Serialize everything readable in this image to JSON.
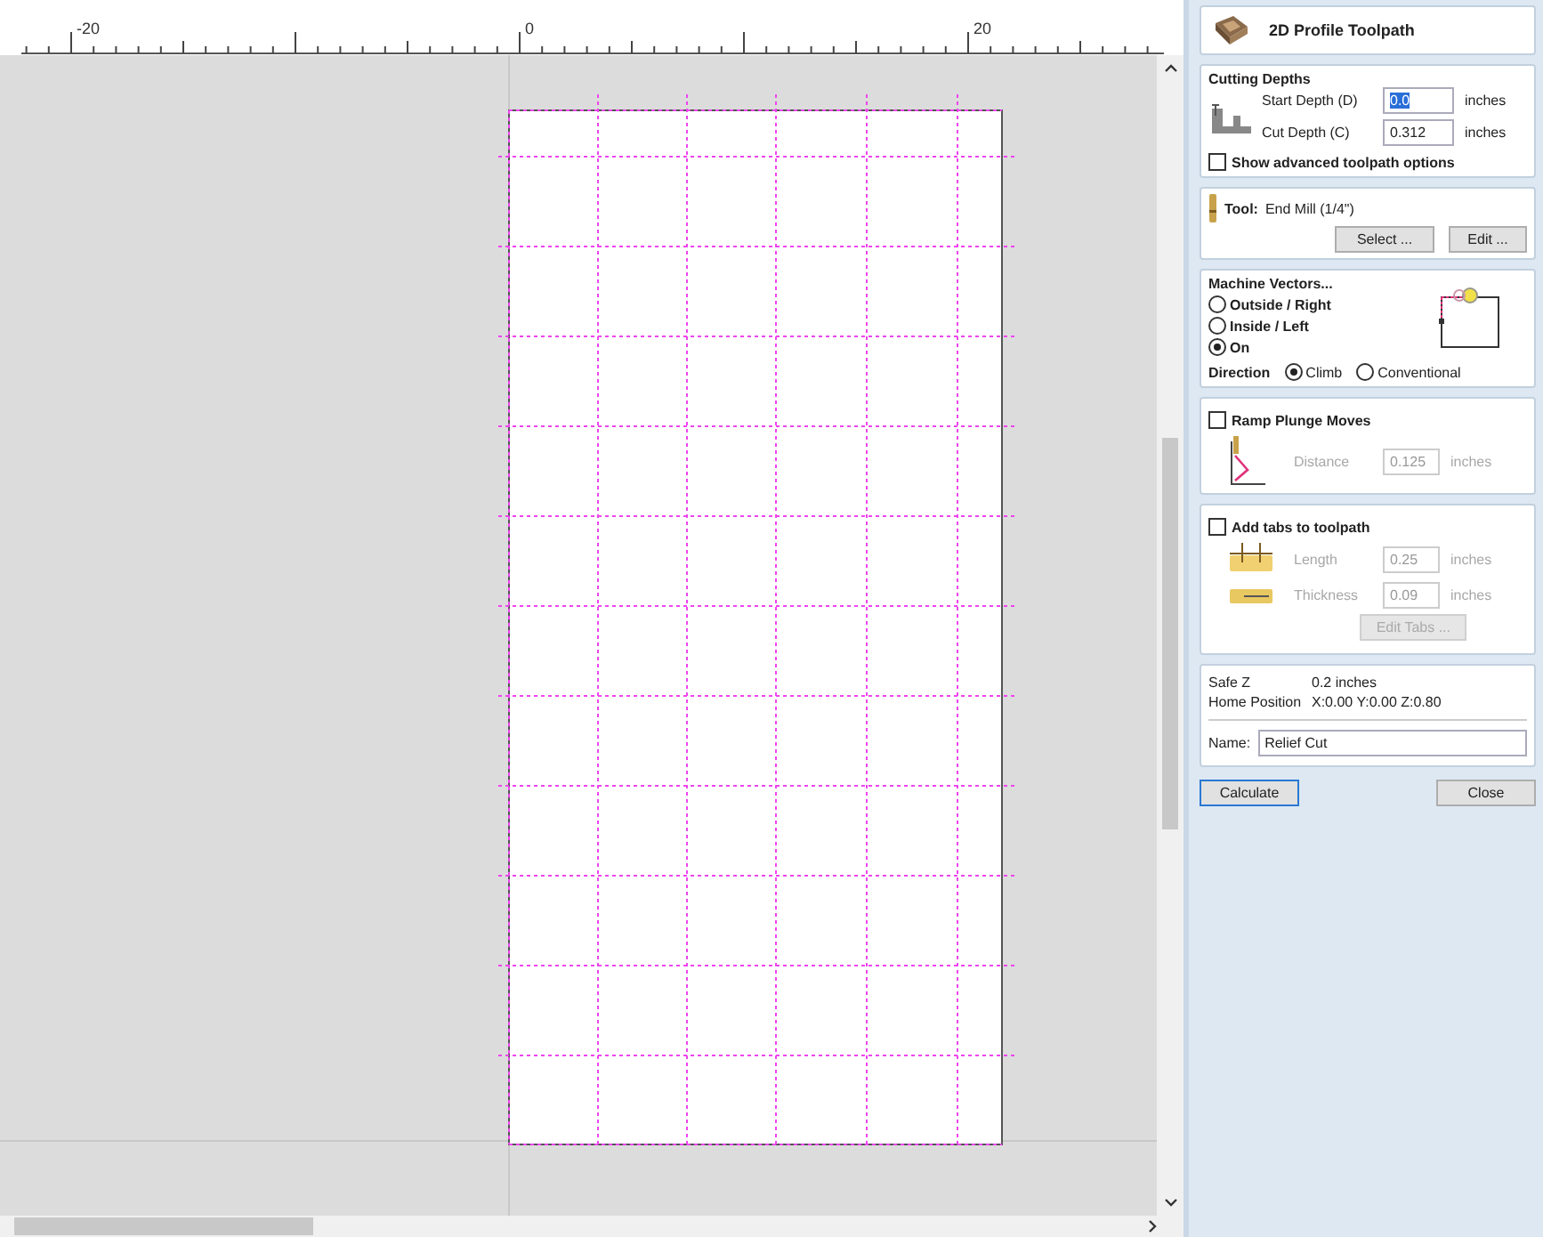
{
  "ruler": {
    "labels": [
      "-20",
      "0",
      "20"
    ]
  },
  "panel": {
    "title": "2D Profile Toolpath",
    "cutting_depths": {
      "heading": "Cutting Depths",
      "fields": [
        {
          "label": "Start Depth (D)",
          "value": "0.0",
          "unit": "inches",
          "selected": true
        },
        {
          "label": "Cut Depth (C)",
          "value": "0.312",
          "unit": "inches",
          "selected": false
        }
      ],
      "advanced": {
        "label": "Show advanced toolpath options",
        "checked": false
      }
    },
    "tool": {
      "label": "Tool:",
      "name": "End Mill (1/4\")",
      "buttons": [
        "Select ...",
        "Edit ..."
      ]
    },
    "machine_vectors": {
      "heading": "Machine Vectors...",
      "options": [
        {
          "label": "Outside / Right",
          "selected": false
        },
        {
          "label": "Inside / Left",
          "selected": false
        },
        {
          "label": "On",
          "selected": true
        }
      ],
      "direction": {
        "label": "Direction",
        "options": [
          {
            "label": "Climb",
            "selected": true
          },
          {
            "label": "Conventional",
            "selected": false
          }
        ]
      }
    },
    "ramp": {
      "label": "Ramp Plunge Moves",
      "checked": false,
      "fields": [
        {
          "label": "Distance",
          "value": "0.125",
          "unit": "inches"
        }
      ]
    },
    "tabs": {
      "label": "Add tabs to toolpath",
      "checked": false,
      "fields": [
        {
          "label": "Length",
          "value": "0.25",
          "unit": "inches"
        },
        {
          "label": "Thickness",
          "value": "0.09",
          "unit": "inches"
        }
      ],
      "button": "Edit Tabs ..."
    },
    "info": [
      {
        "label": "Safe Z",
        "value": "0.2 inches"
      },
      {
        "label": "Home Position",
        "value": "X:0.00 Y:0.00 Z:0.80"
      }
    ],
    "name": {
      "label": "Name:",
      "value": "Relief Cut"
    },
    "buttons": [
      {
        "label": "Calculate",
        "kind": "primary"
      },
      {
        "label": "Close",
        "kind": "normal"
      }
    ]
  }
}
